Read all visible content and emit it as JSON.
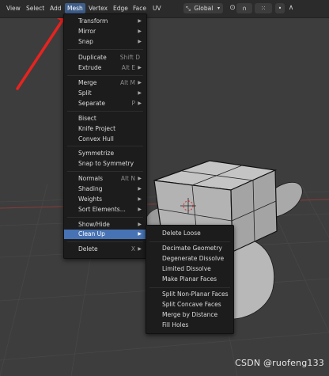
{
  "header": {
    "menus": [
      "View",
      "Select",
      "Add",
      "Mesh",
      "Vertex",
      "Edge",
      "Face",
      "UV"
    ],
    "transform_orientation": "Global"
  },
  "mesh_menu": {
    "items": [
      {
        "label": "Transform",
        "submenu": true
      },
      {
        "label": "Mirror",
        "submenu": true
      },
      {
        "label": "Snap",
        "submenu": true
      },
      {
        "label": "Duplicate",
        "shortcut": "Shift D"
      },
      {
        "label": "Extrude",
        "shortcut": "Alt E",
        "submenu": true
      },
      {
        "label": "Merge",
        "shortcut": "Alt M",
        "submenu": true
      },
      {
        "label": "Split",
        "submenu": true
      },
      {
        "label": "Separate",
        "shortcut": "P",
        "submenu": true
      },
      {
        "label": "Bisect"
      },
      {
        "label": "Knife Project"
      },
      {
        "label": "Convex Hull"
      },
      {
        "label": "Symmetrize"
      },
      {
        "label": "Snap to Symmetry"
      },
      {
        "label": "Normals",
        "shortcut": "Alt N",
        "submenu": true
      },
      {
        "label": "Shading",
        "submenu": true
      },
      {
        "label": "Weights",
        "submenu": true
      },
      {
        "label": "Sort Elements...",
        "submenu": true
      },
      {
        "label": "Show/Hide",
        "submenu": true
      },
      {
        "label": "Clean Up",
        "submenu": true,
        "highlighted": true
      },
      {
        "label": "Delete",
        "shortcut": "X",
        "submenu": true
      }
    ]
  },
  "cleanup_menu": {
    "items": [
      "Delete Loose",
      "Decimate Geometry",
      "Degenerate Dissolve",
      "Limited Dissolve",
      "Make Planar Faces",
      "Split Non-Planar Faces",
      "Split Concave Faces",
      "Merge by Distance",
      "Fill Holes"
    ]
  },
  "watermark": "CSDN @ruofeng133",
  "colors": {
    "accent": "#4772b3",
    "annotation_arrow": "#e8231f"
  }
}
